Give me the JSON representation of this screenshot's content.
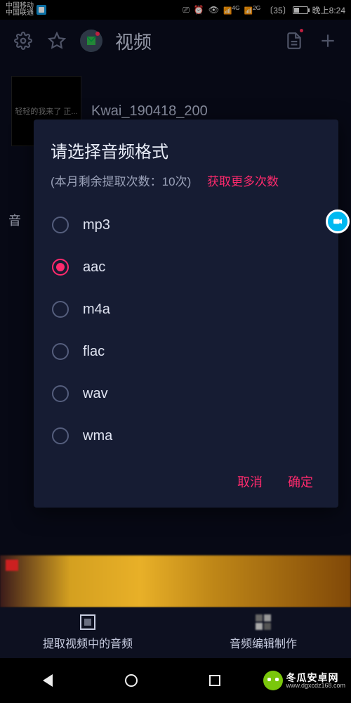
{
  "status": {
    "carrier1": "中国移动",
    "carrier2": "中国联通",
    "net1": "4G",
    "net2": "2G",
    "battery_pct": "35",
    "time": "晚上8:24"
  },
  "toolbar": {
    "title": "视频"
  },
  "file": {
    "thumb_text": "轻轻的我来了\n正...",
    "name": "Kwai_190418_200"
  },
  "side_tab_hint": "音",
  "dialog": {
    "title": "请选择音频格式",
    "quota_text": "(本月剩余提取次数：10次)",
    "get_more": "获取更多次数",
    "options": [
      "mp3",
      "aac",
      "m4a",
      "flac",
      "wav",
      "wma"
    ],
    "selected_index": 1,
    "cancel": "取消",
    "confirm": "确定"
  },
  "tabs": {
    "extract": "提取视频中的音频",
    "edit": "音频编辑制作"
  },
  "brand": {
    "name": "冬瓜安卓网",
    "url": "www.dgxcdz168.com"
  }
}
